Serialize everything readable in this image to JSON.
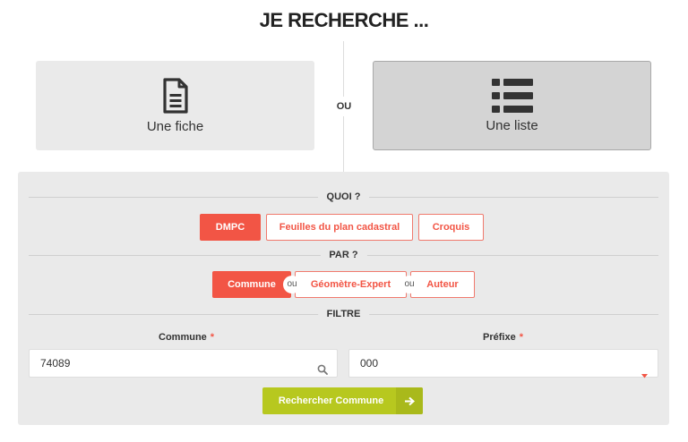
{
  "page_title": "JE RECHERCHE ...",
  "choices": {
    "fiche_label": "Une fiche",
    "liste_label": "Une liste",
    "separator": "OU"
  },
  "quoi": {
    "heading": "QUOI ?",
    "options": [
      "DMPC",
      "Feuilles du plan cadastral",
      "Croquis"
    ],
    "active": "DMPC"
  },
  "par": {
    "heading": "PAR ?",
    "options": [
      "Commune",
      "Géomètre-Expert",
      "Auteur"
    ],
    "separator": "ou",
    "active": "Commune"
  },
  "filtre": {
    "heading": "FILTRE",
    "commune_label": "Commune",
    "commune_value": "74089",
    "prefixe_label": "Préfixe",
    "prefixe_value": "000",
    "required_mark": "*"
  },
  "submit_label": "Rechercher Commune",
  "colors": {
    "accent_red": "#f25545",
    "accent_green": "#b7c81f",
    "panel_bg": "#eaeaea"
  }
}
